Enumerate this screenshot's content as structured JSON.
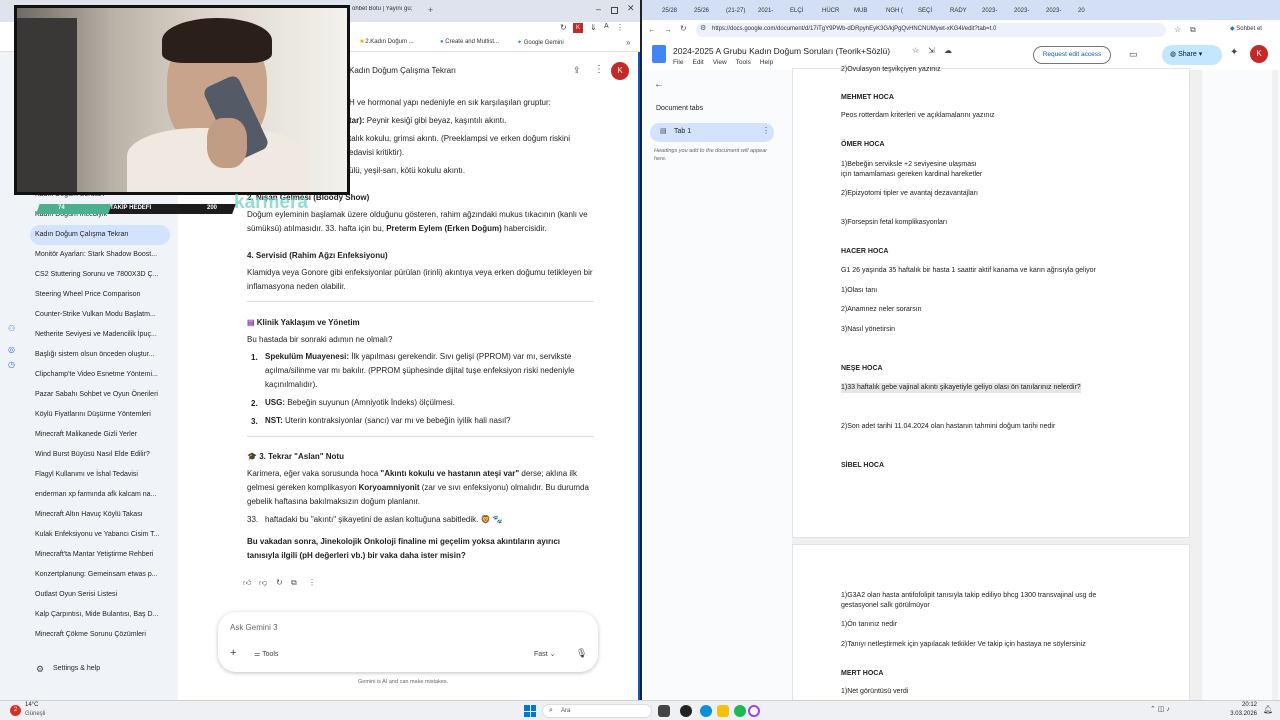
{
  "left_browser": {
    "tabs": [
      "ohbet Botu | Yayını gü;"
    ],
    "bookmarks": [
      "2.Kadın Doğum ...",
      "Create and Multist...",
      "Google Gemini"
    ],
    "chat_title": "Kadın Doğum Çalışma Tekrarı",
    "avatar": "K"
  },
  "sidebar": {
    "items": [
      "Kadın Doğum Soruları",
      "Kadın Doğum İncebiyik",
      "Kadın Doğum Çalışma Tekrarı",
      "Monitör Ayarları: Stark Shadow Boost...",
      "CS2 Stuttering Sorunu ve 7800X3D Ç...",
      "Steering Wheel Price Comparison",
      "Counter-Strike Vulkan Modu Başlatm...",
      "Netherite Seviyesi ve Madencilik İpuç...",
      "Başlığı sistem olsun önceden oluştur...",
      "Clipchamp'te Video Esnetme Yöntemi...",
      "Pazar Sabahı Sohbet ve Oyun Önerileri",
      "Köylü Fiyatlarını Düşürme Yöntemleri",
      "Minecraft Malikanede Gizli Yerler",
      "Wind Burst Büyüsü Nasıl Elde Edilir?",
      "Flagyl Kullanımı ve İshal Tedavisi",
      "enderman xp farmında afk kalcam na...",
      "Minecraft Altın Havuç Köylü Takası",
      "Kulak Enfeksiyonu ve Yabancı Cisim T...",
      "Minecraft'ta Mantar Yetiştirme Rehberi",
      "Konzertplanung: Gemeinsam etwas p...",
      "Outlast Oyun Serisi Listesi",
      "Kalp Çarpıntısı, Mide Bulantısı, Baş D...",
      "Minecraft Çökme Sorunu Çözümleri"
    ],
    "active_index": 2,
    "settings": "Settings & help"
  },
  "overlay": {
    "label": "TAKİP HEDEFİ",
    "value": "200",
    "left": "74",
    "brand": "karmera"
  },
  "chat": {
    "line1": "H ve hormonal yapı nedeniyle en sık karşılaşılan gruptur:",
    "line2_b": "tar):",
    "line2": " Peynir kesiği gibi beyaz, kaşıntılı akıntı.",
    "line3": "talık kokulu, grimsi akıntı. (Preeklampsi ve erken doğum riskini",
    "line4": "edavisi kritiktir).",
    "line5": "ülü, yeşil-sarı, kötü kokulu akıntı.",
    "h2": "2. Nişan Gelmesi (Bloody Show)",
    "p2a": "Doğum eyleminin başlamak üzere olduğunu gösteren, rahim ağzındaki mukus tıkacının (kanlı ve",
    "p2b": "sümüksü) atılmasıdır. 33. hafta için bu,",
    "p2b_b": "Preterm Eylem (Erken Doğum)",
    "p2b_end": " habercisidir.",
    "h4": "4. Servisid (Rahim Ağzı Enfeksiyonu)",
    "p4a": "Klamidya veya Gonore gibi enfeksiyonlar pürülan (irinli) akıntıya veya erken doğumu tetikleyen bir",
    "p4b": "inflamasyona neden olabilir.",
    "hk": "Klinik Yaklaşım ve Yönetim",
    "q": "Bu hastada bir sonraki adımın ne olmalı?",
    "l1_b": "Spekulüm Muayenesi:",
    "l1": " İlk yapılması gerekendir. Sıvı gelişi (PPROM) var mı, servikste",
    "l1b": "açılma/silinme var mı bakılır. (PPROM şüphesinde dijital tuşe enfeksiyon riski nedeniyle",
    "l1c": "kaçınılmalıdır).",
    "l2_b": "USG:",
    "l2": " Bebeğin suyunun (Amniyotik İndeks) ölçülmesi.",
    "l3_b": "NST:",
    "l3": " Uterin kontraksiyonlar (sancı) var mı ve bebeğin iyilik hali nasıl?",
    "h3": "3. Tekrar \"Aslan\" Notu",
    "p3a": "Karimera, eğer vaka sorusunda hoca ",
    "p3a_b": "\"Akıntı kokulu ve hastanın ateşi var\"",
    "p3a_end": " derse; aklına ilk",
    "p3b": "gelmesi gereken komplikasyon ",
    "p3b_b": "Koryoamniyonit",
    "p3b_end": " (zar ve sıvı enfeksiyonu) olmalıdır. Bu durumda",
    "p3c": "gebelik haftasına bakılmaksızın doğum planlanır.",
    "p3d_num": "33.",
    "p3d": "haftadaki bu \"akıntı\" şikayetini de aslan koltuğuna sabitledik. 🦁 🐾",
    "final_a": "Bu vakadan sonra, Jinekolojik Onkoloji finaline mi geçelim yoksa akıntıların ayırıcı",
    "final_b": "tanısıyla ilgili (pH değerleri vb.) bir vaka daha ister misin?",
    "input_placeholder": "Ask Gemini 3",
    "tools": "Tools",
    "mode": "Fast",
    "disclaimer": "Gemini is AI and can make mistakes."
  },
  "right_browser": {
    "tabs": [
      "25/28",
      "25/26",
      "(21-27)",
      "2021-",
      "ELÇİ",
      "HÜCR",
      "MUB",
      "NGH (",
      "SEÇİ",
      "RADY",
      "2023-",
      "2023-",
      "2023-",
      "20"
    ],
    "url": "https://docs.google.com/document/d/17iTgY9PWb-dDRpyhEyK3G/kjPgQvHNCNUMywt-xKG4l/edit?tab=t.0",
    "profile_text": "Sohbet et",
    "doc_title": "2024-2025 A Grubu Kadın Doğum Soruları (Teorik+Sözlü)",
    "menus": [
      "File",
      "Edit",
      "View",
      "Tools",
      "Help"
    ],
    "request": "Request edit access",
    "share": "Share",
    "avatar": "K",
    "doc_tabs_title": "Document tabs",
    "tab1": "Tab 1",
    "tab_hint": "Headings you add to the document will appear here."
  },
  "doc": {
    "p1": [
      {
        "t": "2)Ovulasyon teşvikçiyen yazınız",
        "h": false
      },
      {
        "t": "MEHMET HOCA",
        "h": true
      },
      {
        "t": "Peos rotterdam kriterleri ve açıklamalarını yazınız",
        "h": false
      },
      {
        "t": "ÖMER HOCA",
        "h": true
      },
      {
        "t": "1)Bebeğin serviksle +2 seviyesine ulaşması",
        "h": false
      },
      {
        "t": "için tamamlaması gereken kardinal hareketler",
        "h": false
      },
      {
        "t": "2)Epizyotomi tipler ve avantaj dezavantajları",
        "h": false
      },
      {
        "t": "3)Forsepsin fetal komplikasyonları",
        "h": false
      },
      {
        "t": "HACER HOCA",
        "h": true
      },
      {
        "t": "G1 26 yaşında 35 haftalık bir hasta 1 saattir aktif kanama ve karın ağrısıyla geliyor",
        "h": false
      },
      {
        "t": "1)Olası tanı",
        "h": false
      },
      {
        "t": "2)Anamnez neler sorarsın",
        "h": false
      },
      {
        "t": "3)Nasıl yönetirsin",
        "h": false
      },
      {
        "t": "NEŞE HOCA",
        "h": true
      },
      {
        "t": "1)33 haftalık gebe vajinal akıntı şikayetiyle geliyo olası ön tanılarınız nelerdir?",
        "h": false
      },
      {
        "t": "2)Son adet tarihi 11.04.2024 olan hastanın tahmini doğum tarihi nedir",
        "h": false
      },
      {
        "t": "SİBEL HOCA",
        "h": true
      }
    ],
    "p2": [
      {
        "t": "1)G3A2 olan hasta antifofolipit tanısıyla takip ediliyo bhcg 1300 transvajinal usg de",
        "h": false
      },
      {
        "t": "gestasyonel salk görülmüyor",
        "h": false
      },
      {
        "t": "1)Ön tanınız nedir",
        "h": false
      },
      {
        "t": "2)Tanıyı netleştirmek için yapılacak tetkikler Ve takip için hastaya ne söylersiniz",
        "h": false
      },
      {
        "t": "MERT HOCA",
        "h": true
      },
      {
        "t": "1)Net görüntüsü verdi",
        "h": false
      }
    ]
  },
  "taskbar": {
    "weather_temp": "14°C",
    "weather_desc": "Güneşli",
    "search": "Ara",
    "time": "20:12",
    "date": "3.03.2026"
  }
}
